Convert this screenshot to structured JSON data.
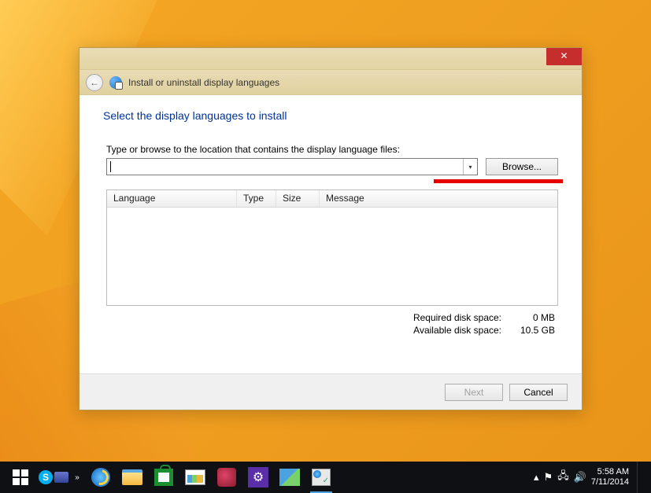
{
  "window": {
    "title": "Install or uninstall display languages",
    "heading": "Select the display languages to install",
    "pathLabel": "Type or browse to the location that contains the display language files:",
    "pathValue": "",
    "browseLabel": "Browse...",
    "columns": {
      "language": "Language",
      "type": "Type",
      "size": "Size",
      "message": "Message"
    },
    "diskRequired": {
      "label": "Required disk space:",
      "value": "0 MB"
    },
    "diskAvailable": {
      "label": "Available disk space:",
      "value": "10.5 GB"
    },
    "nextLabel": "Next",
    "cancelLabel": "Cancel"
  },
  "taskbar": {
    "time": "5:58 AM",
    "date": "7/11/2014"
  }
}
